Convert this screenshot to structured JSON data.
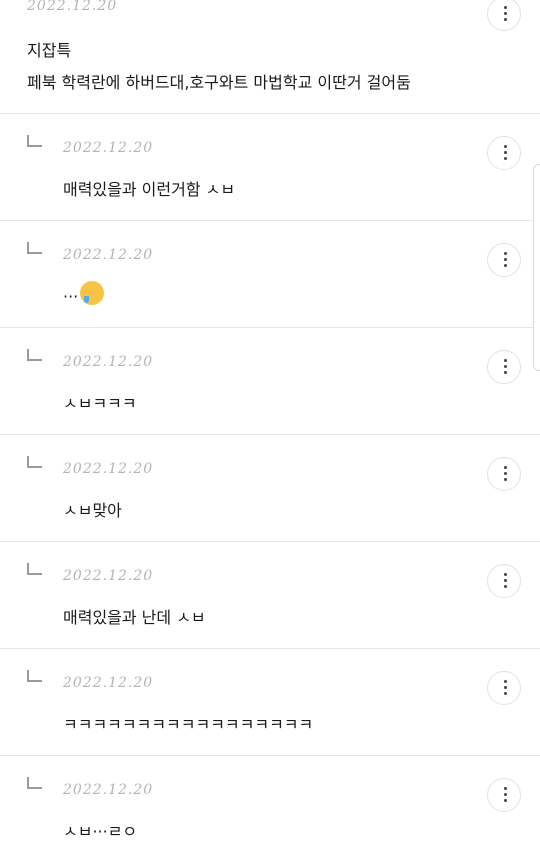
{
  "post": {
    "date": "2022.12.20",
    "title": "지잡특",
    "body": "페북 학력란에 하버드대,호구와트 마법학교 이딴거 걸어둠"
  },
  "replies": [
    {
      "date": "2022.12.20",
      "text": "매력있을과 이런거함 ㅅㅂ"
    },
    {
      "date": "2022.12.20",
      "text": "...",
      "emoji": "smiling-face-with-tear-icon"
    },
    {
      "date": "2022.12.20",
      "text": "ㅅㅂㅋㅋㅋ"
    },
    {
      "date": "2022.12.20",
      "text": "ㅅㅂ맞아"
    },
    {
      "date": "2022.12.20",
      "text": "매력있을과 난데 ㅅㅂ"
    },
    {
      "date": "2022.12.20",
      "text": "ㅋㅋㅋㅋㅋㅋㅋㅋㅋㅋㅋㅋㅋㅋㅋㅋㅋ"
    },
    {
      "date": "2022.12.20",
      "text": "ㅅㅂ···ㄹㅇ"
    }
  ],
  "icons": {
    "more": "more-vertical-icon",
    "reply": "reply-arrow-icon"
  }
}
